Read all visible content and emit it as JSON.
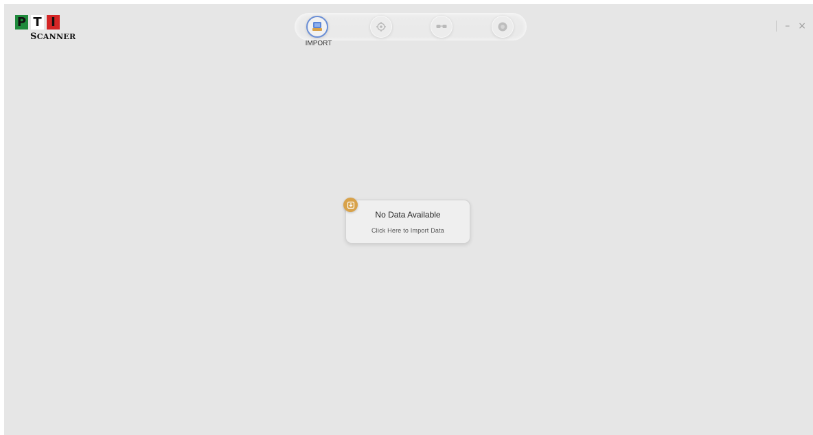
{
  "logo": {
    "letters": [
      "P",
      "T",
      "I"
    ],
    "subtitle_first": "S",
    "subtitle_rest": "CANNER"
  },
  "nav": {
    "items": [
      {
        "icon": "import-icon",
        "label": "IMPORT",
        "active": true
      },
      {
        "icon": "target-icon",
        "active": false
      },
      {
        "icon": "glasses-icon",
        "active": false
      },
      {
        "icon": "record-icon",
        "active": false
      }
    ],
    "active_label": "IMPORT"
  },
  "window_controls": {
    "minimize": "–",
    "close": "×"
  },
  "empty_state": {
    "title": "No Data Available",
    "action": "Click Here to Import Data",
    "badge_icon": "download-icon",
    "badge_color": "#d8a24a"
  },
  "colors": {
    "background": "#e6e6e6",
    "accent": "#6b8fd6",
    "logo_green": "#1f8a3c",
    "logo_red": "#d42626"
  }
}
